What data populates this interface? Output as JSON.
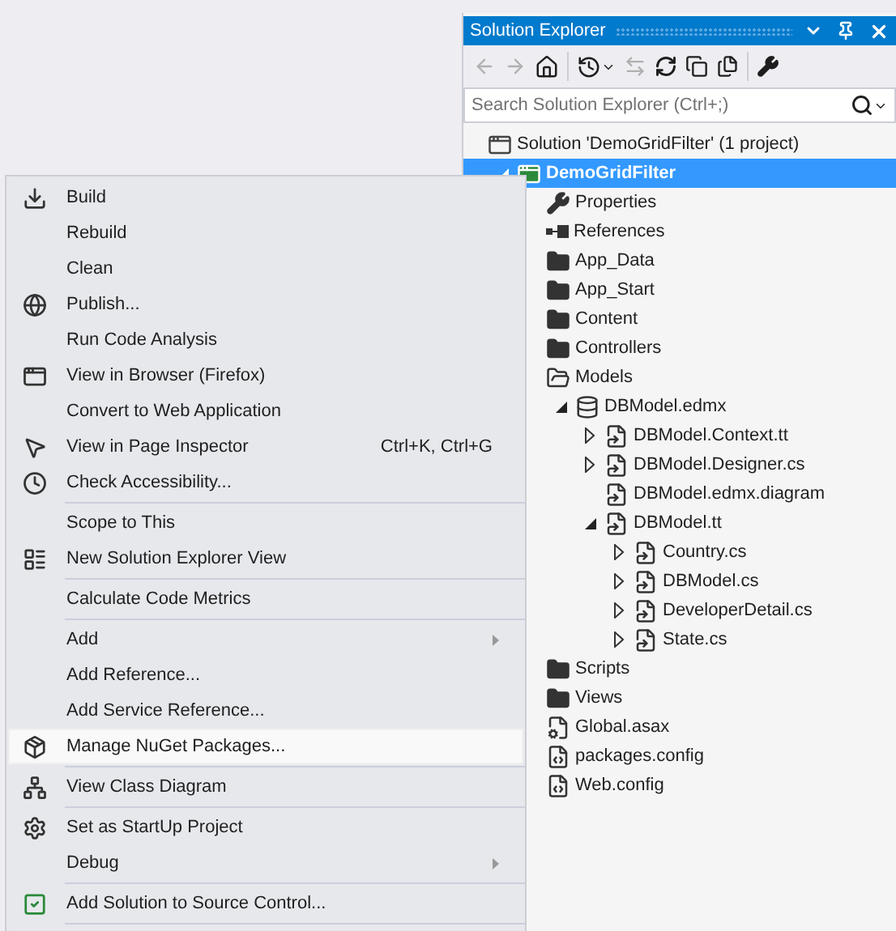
{
  "panel": {
    "title": "Solution Explorer",
    "search": {
      "placeholder": "Search Solution Explorer (Ctrl+;)"
    },
    "tree": [
      {
        "label": "Solution 'DemoGridFilter' (1 project)",
        "kind": "solution",
        "selected": false,
        "children": [
          {
            "label": "DemoGridFilter",
            "kind": "project",
            "expanded": true,
            "selected": true,
            "children": [
              {
                "label": "Properties",
                "kind": "wrench",
                "selected": false
              },
              {
                "label": "References",
                "kind": "references",
                "selected": false
              },
              {
                "label": "App_Data",
                "kind": "folder",
                "selected": false
              },
              {
                "label": "App_Start",
                "kind": "folder",
                "selected": false
              },
              {
                "label": "Content",
                "kind": "folder",
                "selected": false
              },
              {
                "label": "Controllers",
                "kind": "folder",
                "selected": false
              },
              {
                "label": "Models",
                "kind": "folder-open",
                "selected": false,
                "children": [
                  {
                    "label": "DBModel.edmx",
                    "kind": "edmx",
                    "expanded": true,
                    "selected": false,
                    "children": [
                      {
                        "label": "DBModel.Context.tt",
                        "kind": "linked-file",
                        "expanded": false,
                        "selected": false
                      },
                      {
                        "label": "DBModel.Designer.cs",
                        "kind": "linked-file",
                        "expanded": false,
                        "selected": false
                      },
                      {
                        "label": "DBModel.edmx.diagram",
                        "kind": "linked-file",
                        "selected": false
                      },
                      {
                        "label": "DBModel.tt",
                        "kind": "linked-file",
                        "expanded": true,
                        "selected": false,
                        "children": [
                          {
                            "label": "Country.cs",
                            "kind": "linked-file",
                            "expanded": false,
                            "selected": false
                          },
                          {
                            "label": "DBModel.cs",
                            "kind": "linked-file",
                            "expanded": false,
                            "selected": false
                          },
                          {
                            "label": "DeveloperDetail.cs",
                            "kind": "linked-file",
                            "expanded": false,
                            "selected": false
                          },
                          {
                            "label": "State.cs",
                            "kind": "linked-file",
                            "expanded": false,
                            "selected": false
                          }
                        ]
                      }
                    ]
                  }
                ]
              },
              {
                "label": "Scripts",
                "kind": "folder",
                "selected": false
              },
              {
                "label": "Views",
                "kind": "folder",
                "selected": false
              },
              {
                "label": "Global.asax",
                "kind": "gear-file",
                "selected": false
              },
              {
                "label": "packages.config",
                "kind": "config-file",
                "selected": false
              },
              {
                "label": "Web.config",
                "kind": "config-file",
                "selected": false
              }
            ]
          }
        ]
      }
    ]
  },
  "context_menu": {
    "groups": [
      [
        {
          "label": "Build",
          "kind": "build",
          "submenu": false,
          "selected": false
        },
        {
          "label": "Rebuild",
          "submenu": false,
          "selected": false
        },
        {
          "label": "Clean",
          "submenu": false,
          "selected": false
        },
        {
          "label": "Publish...",
          "kind": "globe",
          "submenu": false,
          "selected": false
        },
        {
          "label": "Run Code Analysis",
          "submenu": false,
          "selected": false
        },
        {
          "label": "View in Browser (Firefox)",
          "kind": "browser",
          "submenu": false,
          "selected": false
        },
        {
          "label": "Convert to Web Application",
          "submenu": false,
          "selected": false
        },
        {
          "label": "View in Page Inspector",
          "shortcut": "Ctrl+K, Ctrl+G",
          "kind": "inspector",
          "submenu": false,
          "selected": false
        },
        {
          "label": "Check Accessibility...",
          "kind": "clock",
          "submenu": false,
          "selected": false
        }
      ],
      [
        {
          "label": "Scope to This",
          "submenu": false,
          "selected": false
        },
        {
          "label": "New Solution Explorer View",
          "kind": "window-list",
          "submenu": false,
          "selected": false
        }
      ],
      [
        {
          "label": "Calculate Code Metrics",
          "submenu": false,
          "selected": false
        }
      ],
      [
        {
          "label": "Add",
          "submenu": true,
          "selected": false
        },
        {
          "label": "Add Reference...",
          "submenu": false,
          "selected": false
        },
        {
          "label": "Add Service Reference...",
          "submenu": false,
          "selected": false
        },
        {
          "label": "Manage NuGet Packages...",
          "kind": "package",
          "submenu": false,
          "selected": true
        }
      ],
      [
        {
          "label": "View Class Diagram",
          "kind": "diagram",
          "submenu": false,
          "selected": false
        }
      ],
      [
        {
          "label": "Set as StartUp Project",
          "kind": "gear",
          "submenu": false,
          "selected": false
        },
        {
          "label": "Debug",
          "submenu": true,
          "selected": false
        }
      ],
      [
        {
          "label": "Add Solution to Source Control...",
          "kind": "source-control",
          "submenu": false,
          "selected": false
        }
      ]
    ]
  }
}
